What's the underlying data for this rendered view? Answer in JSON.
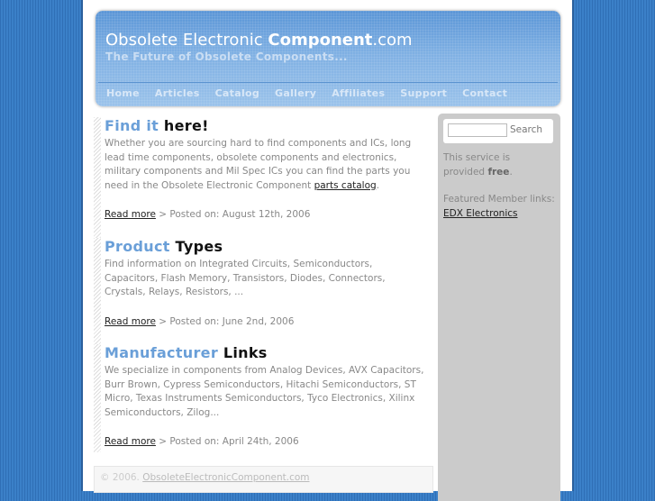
{
  "header": {
    "title_prefix": "Obsolete Electronic ",
    "title_bold": "Component",
    "title_suffix": ".com",
    "tagline": "The Future of Obsolete Components..."
  },
  "nav": [
    "Home",
    "Articles",
    "Catalog",
    "Gallery",
    "Affiliates",
    "Support",
    "Contact"
  ],
  "posts": [
    {
      "title_highlight": "Find it",
      "title_rest": " here!",
      "body": "Whether you are sourcing hard to find components and ICs, long lead time components, obsolete components and electronics, military components and Mil Spec ICs you can find the parts you need in the Obsolete Electronic Component ",
      "link": "parts catalog",
      "after": ".",
      "read_more": "Read more",
      "posted": " > Posted on: August 12th, 2006"
    },
    {
      "title_highlight": "Product",
      "title_rest": " Types",
      "body": "Find information on Integrated Circuits, Semiconductors, Capacitors, Flash Memory, Transistors, Diodes, Connectors, Crystals, Relays, Resistors, ...",
      "read_more": "Read more",
      "posted": " > Posted on: June 2nd, 2006"
    },
    {
      "title_highlight": "Manufacturer",
      "title_rest": " Links",
      "body": "We specialize in components from Analog Devices, AVX Capacitors, Burr Brown, Cypress Semiconductors, Hitachi Semiconductors, ST Micro, Texas Instruments Semiconductors, Tyco Electronics, Xilinx Semiconductors, Zilog...",
      "read_more": "Read more",
      "posted": " > Posted on: April 24th, 2006"
    }
  ],
  "sidebar": {
    "search_button": "Search",
    "search_value": "",
    "service_text": "This service is provided ",
    "service_bold": "free",
    "service_after": ".",
    "featured_label": "Featured Member links:",
    "featured_link": "EDX Electronics"
  },
  "footer": {
    "copyright": "© 2006. ",
    "link": "ObsoleteElectronicComponent.com"
  }
}
